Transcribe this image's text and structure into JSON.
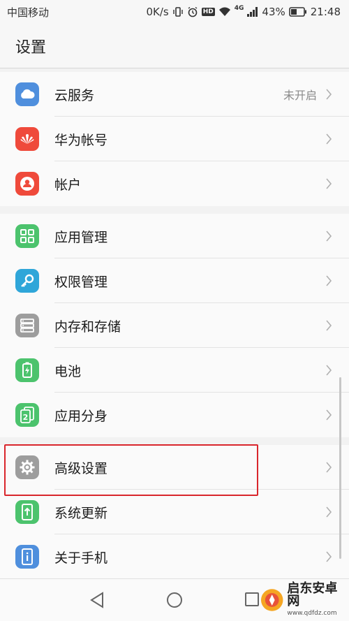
{
  "status_bar": {
    "carrier": "中国移动",
    "speed": "0K/s",
    "network": "4G",
    "battery_percent": "43%",
    "time": "21:48",
    "hd_badge": "HD"
  },
  "header": {
    "title": "设置"
  },
  "groups": [
    {
      "items": [
        {
          "label": "云服务",
          "value": "未开启",
          "icon": "cloud-icon",
          "color": "#4f8fdd"
        },
        {
          "label": "华为帐号",
          "icon": "huawei-logo-icon",
          "color": "#ef4a3b"
        },
        {
          "label": "帐户",
          "icon": "user-icon",
          "color": "#ef4a3b"
        }
      ]
    },
    {
      "items": [
        {
          "label": "应用管理",
          "icon": "apps-grid-icon",
          "color": "#4cc36d"
        },
        {
          "label": "权限管理",
          "icon": "key-icon",
          "color": "#2fa6d9"
        },
        {
          "label": "内存和存储",
          "icon": "storage-icon",
          "color": "#9d9d9d"
        },
        {
          "label": "电池",
          "icon": "battery-icon",
          "color": "#4cc36d"
        },
        {
          "label": "应用分身",
          "icon": "app-twin-icon",
          "color": "#4cc36d"
        }
      ]
    },
    {
      "items": [
        {
          "label": "高级设置",
          "icon": "gear-icon",
          "color": "#9d9d9d"
        },
        {
          "label": "系统更新",
          "icon": "system-update-icon",
          "color": "#4cc36d"
        },
        {
          "label": "关于手机",
          "icon": "phone-info-icon",
          "color": "#4f8fdd"
        }
      ]
    }
  ],
  "watermark": {
    "text": "启东安卓网",
    "url": "www.qdfdz.com"
  },
  "highlight_color": "#d9262c"
}
